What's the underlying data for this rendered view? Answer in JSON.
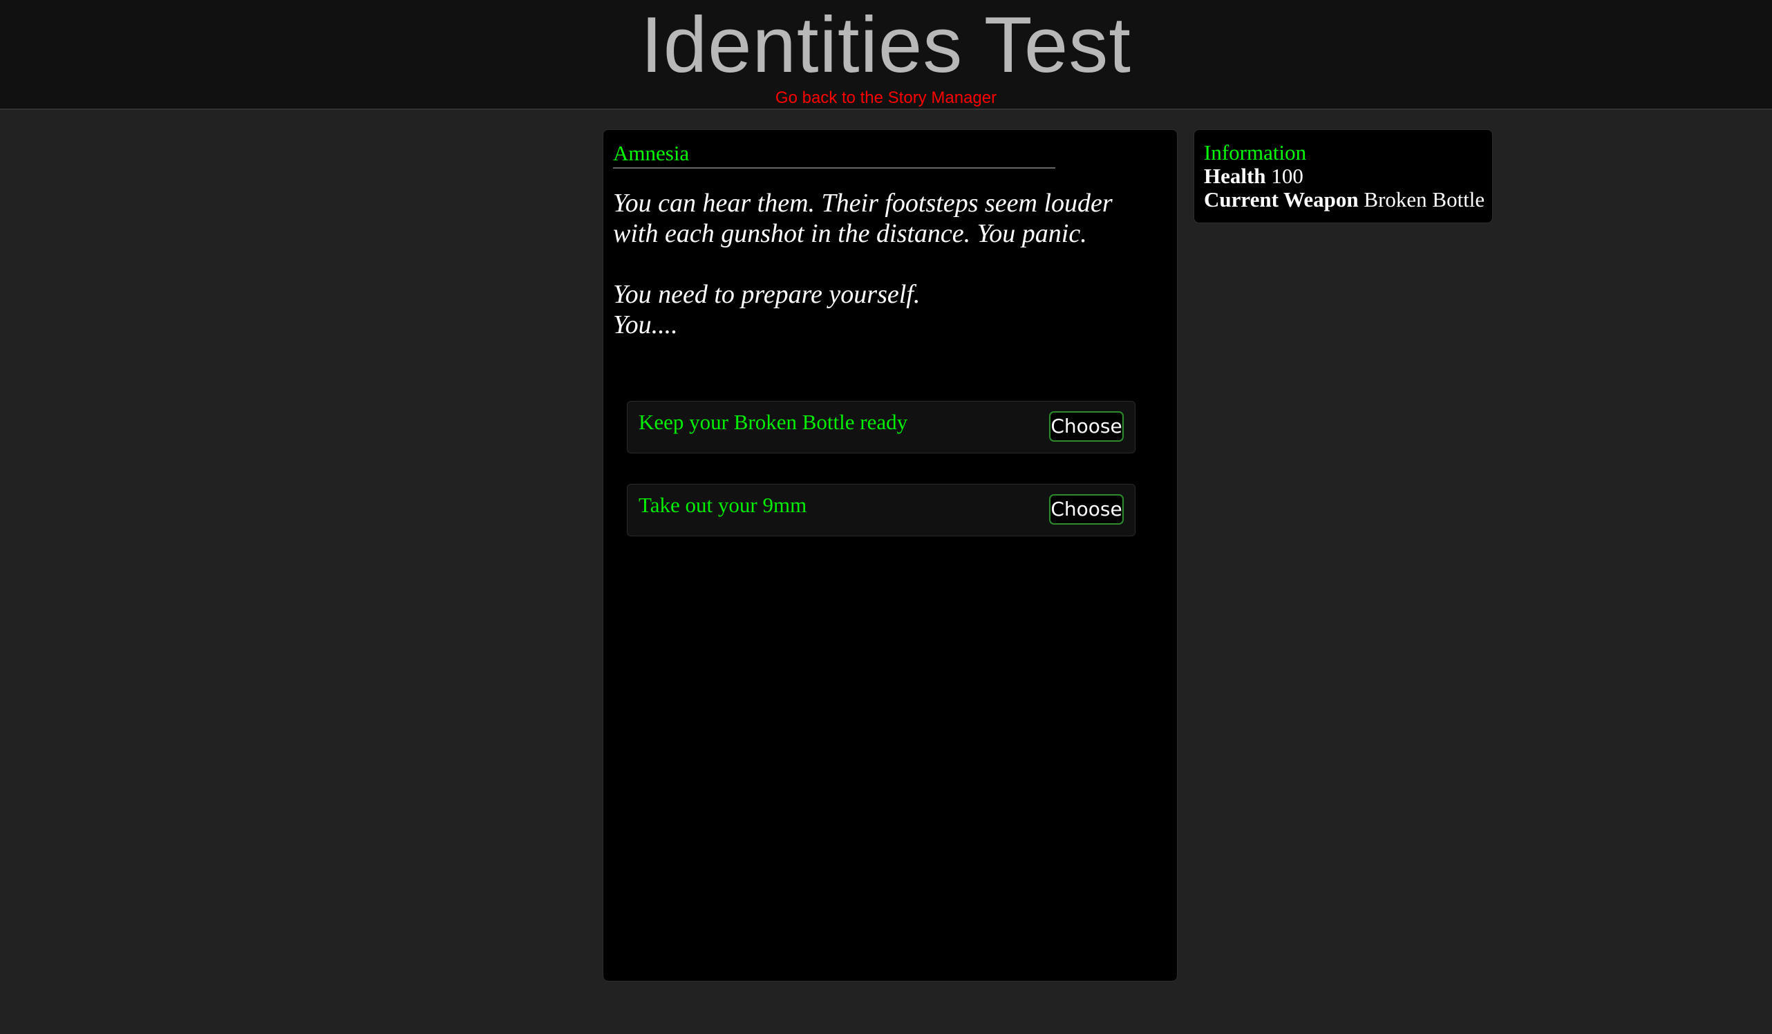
{
  "header": {
    "title": "Identities Test",
    "back_link": "Go back to the Story Manager"
  },
  "story": {
    "title": "Amnesia",
    "paragraphs": [
      "You can hear them. Their footsteps seem louder with each gunshot in the distance. You panic.",
      "You need to prepare yourself.",
      "You...."
    ],
    "choices": [
      {
        "label": "Keep your Broken Bottle ready",
        "button": "Choose"
      },
      {
        "label": "Take out your 9mm",
        "button": "Choose"
      }
    ]
  },
  "info": {
    "title": "Information",
    "health_label": "Health",
    "health_value": "100",
    "weapon_label": "Current Weapon",
    "weapon_value": "Broken Bottle"
  },
  "colors": {
    "page_background": "#222222",
    "header_background": "#111111",
    "panel_background": "#000000",
    "accent_green": "#00ff00",
    "link_red": "#ff0000",
    "title_gray": "#b8b8b8"
  }
}
